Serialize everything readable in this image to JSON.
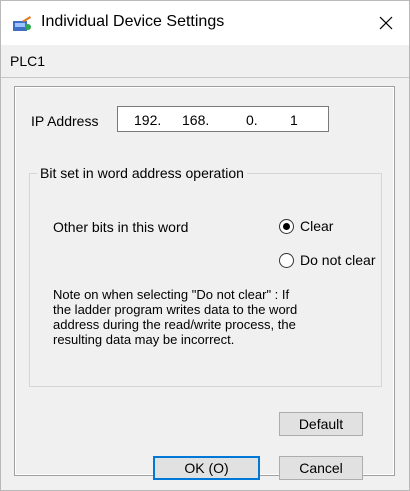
{
  "window": {
    "title": "Individual Device Settings",
    "icon": "device-settings-icon",
    "close_icon": "close-icon"
  },
  "device": {
    "name": "PLC1"
  },
  "ip": {
    "label": "IP Address",
    "octets": [
      "192.",
      "168.",
      "0.",
      "1"
    ]
  },
  "bitset": {
    "group_title": "Bit set in word address operation",
    "other_bits_label": "Other bits in this word",
    "options": [
      {
        "label": "Clear",
        "selected": true
      },
      {
        "label": "Do not clear",
        "selected": false
      }
    ],
    "note": "Note on when selecting \"Do not clear\" : If\nthe ladder program writes data to the word\naddress during the read/write process, the\nresulting data may be incorrect."
  },
  "buttons": {
    "default_label": "Default",
    "ok_label": "OK (O)",
    "cancel_label": "Cancel"
  },
  "colors": {
    "focus_border": "#0078d7",
    "window_bg": "#f0f0f0"
  }
}
